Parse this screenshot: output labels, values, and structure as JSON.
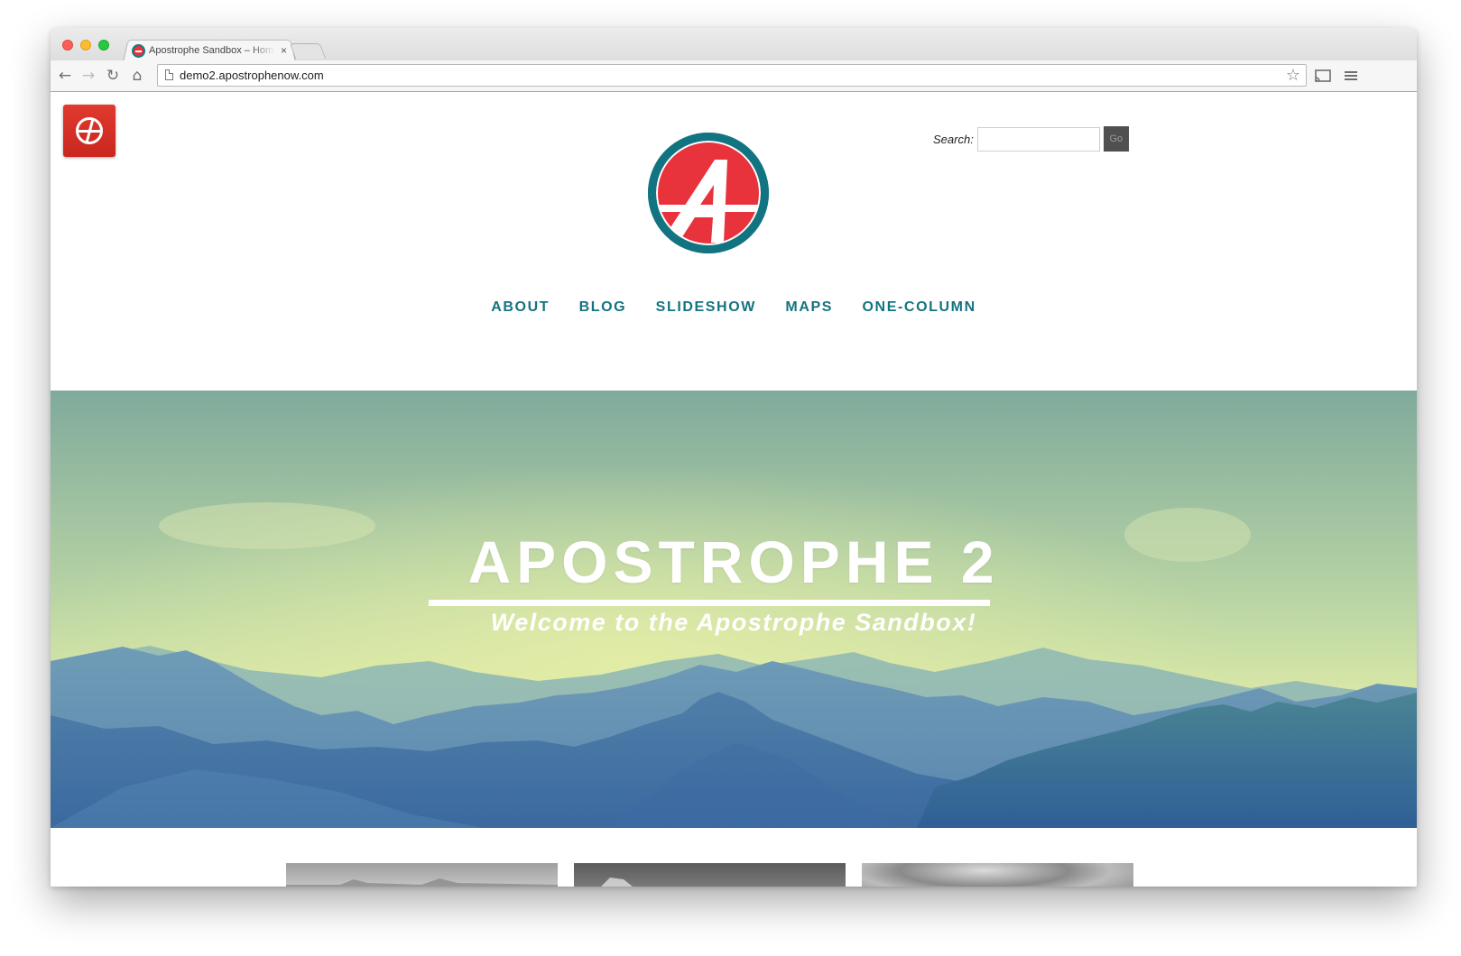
{
  "browser": {
    "tab_title": "Apostrophe Sandbox – Home",
    "tab_close": "×",
    "url": "demo2.apostrophenow.com",
    "icons": {
      "back": "back-arrow-icon",
      "forward": "forward-arrow-icon",
      "reload": "reload-icon",
      "home": "home-icon",
      "bookmark": "star-icon",
      "cast": "cast-icon",
      "menu": "hamburger-menu-icon"
    }
  },
  "header": {
    "search_label": "Search:",
    "search_value": "",
    "search_button": "Go"
  },
  "nav": {
    "items": [
      {
        "label": "ABOUT"
      },
      {
        "label": "BLOG"
      },
      {
        "label": "SLIDESHOW"
      },
      {
        "label": "MAPS"
      },
      {
        "label": "ONE-COLUMN"
      }
    ]
  },
  "hero": {
    "title": "APOSTROPHE 2",
    "subtitle": "Welcome to the Apostrophe Sandbox!"
  },
  "colors": {
    "brand_teal": "#137481",
    "brand_red": "#e8323c",
    "admin_red": "#d52f25",
    "go_button": "#505050"
  }
}
